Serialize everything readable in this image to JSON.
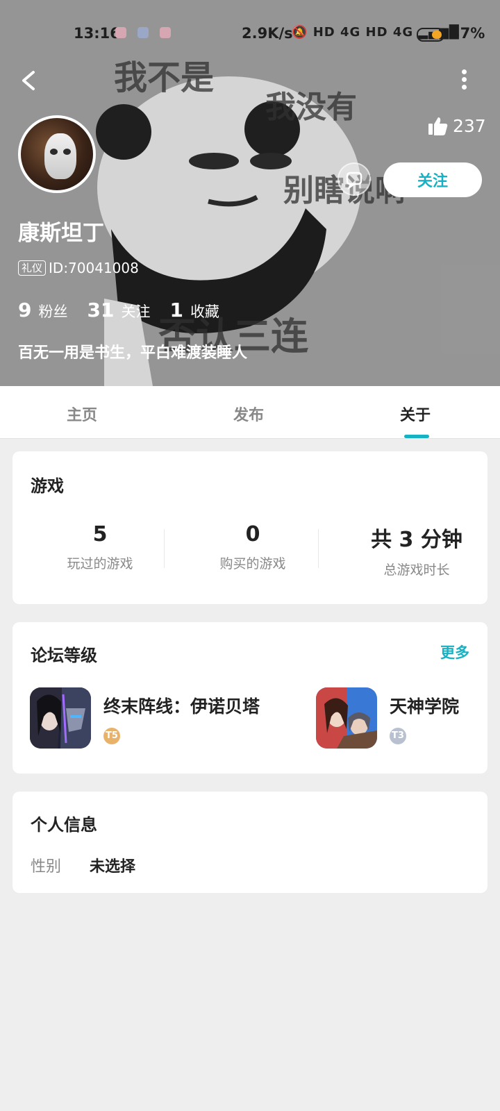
{
  "status_bar": {
    "time": "13:16",
    "speed": "2.9K/s",
    "signal_text": "HD 4G HD 4G",
    "battery": "37%"
  },
  "banner": {
    "meme_top": "我不是",
    "meme_right1": "我没有",
    "meme_right2": "别瞎说啊",
    "meme_bottom": "否认三连"
  },
  "profile": {
    "like_count": "237",
    "follow_label": "关注",
    "username": "康斯坦丁",
    "badge": "礼仪",
    "id": "ID:70041008",
    "stats": [
      {
        "num": "9",
        "label": "粉丝"
      },
      {
        "num": "31",
        "label": "关注"
      },
      {
        "num": "1",
        "label": "收藏"
      }
    ],
    "bio": "百无一用是书生，平白难渡装睡人"
  },
  "tabs": [
    {
      "label": "主页",
      "active": false
    },
    {
      "label": "发布",
      "active": false
    },
    {
      "label": "关于",
      "active": true
    }
  ],
  "games_card": {
    "title": "游戏",
    "stats": [
      {
        "value": "5",
        "label": "玩过的游戏"
      },
      {
        "value": "0",
        "label": "购买的游戏"
      },
      {
        "value": "共 3 分钟",
        "label": "总游戏时长"
      }
    ]
  },
  "forum_card": {
    "title": "论坛等级",
    "more": "更多",
    "games": [
      {
        "name": "终末阵线：伊诺贝塔",
        "level": "T5",
        "level_color": "#e8b26a"
      },
      {
        "name": "天神学院",
        "level": "T3",
        "level_color": "#b9c0cf"
      }
    ]
  },
  "info_card": {
    "title": "个人信息",
    "gender_label": "性别",
    "gender_value": "未选择"
  },
  "colors": {
    "accent": "#16b2c3"
  }
}
